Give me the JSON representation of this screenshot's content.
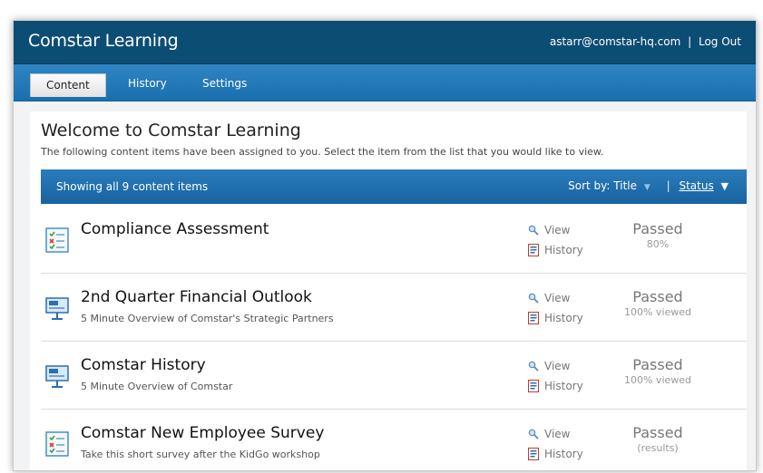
{
  "header": {
    "app_title": "Comstar Learning",
    "user_email": "astarr@comstar-hq.com",
    "separator": "|",
    "logout": "Log Out"
  },
  "nav": {
    "tabs": [
      {
        "label": "Content",
        "active": true
      },
      {
        "label": "History",
        "active": false
      },
      {
        "label": "Settings",
        "active": false
      }
    ]
  },
  "welcome": {
    "title": "Welcome to Comstar Learning",
    "description": "The following content items have been assigned to you. Select the item from the list that you would like to view."
  },
  "list": {
    "showing": "Showing all 9 content items",
    "sort_label": "Sort by:",
    "sort_title": "Title",
    "sort_separator": "|",
    "sort_status": "Status",
    "sort_status_arrow": "▼"
  },
  "items": [
    {
      "title": "Compliance Assessment",
      "subtitle": "",
      "icon": "checklist-icon",
      "view": "View",
      "history": "History",
      "status": "Passed",
      "status_detail": "80%"
    },
    {
      "title": "2nd Quarter Financial Outlook",
      "subtitle": "5 Minute Overview of Comstar's Strategic Partners",
      "icon": "presentation-icon",
      "view": "View",
      "history": "History",
      "status": "Passed",
      "status_detail": "100% viewed"
    },
    {
      "title": "Comstar History",
      "subtitle": "5 Minute Overview of Comstar",
      "icon": "presentation-icon",
      "view": "View",
      "history": "History",
      "status": "Passed",
      "status_detail": "100% viewed"
    },
    {
      "title": "Comstar New Employee Survey",
      "subtitle": "Take this short survey after the KidGo workshop",
      "icon": "checklist-icon",
      "view": "View",
      "history": "History",
      "status": "Passed",
      "status_detail": "(results)"
    }
  ],
  "colors": {
    "header_bg": "#0c4d74",
    "nav_bg": "#1a6fae",
    "list_bar_bg": "#1863a0"
  }
}
